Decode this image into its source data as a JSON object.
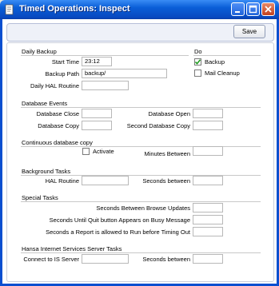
{
  "window": {
    "title": "Timed Operations: Inspect"
  },
  "toolbar": {
    "save_label": "Save"
  },
  "daily_backup": {
    "heading": "Daily Backup",
    "start_time_label": "Start Time",
    "start_time_value": "23:12",
    "backup_path_label": "Backup Path",
    "backup_path_value": "backup/",
    "daily_hal_label": "Daily HAL Routine",
    "daily_hal_value": ""
  },
  "do": {
    "heading": "Do",
    "backup_label": "Backup",
    "backup_checked": true,
    "mail_cleanup_label": "Mail Cleanup",
    "mail_cleanup_checked": false
  },
  "database_events": {
    "heading": "Database Events",
    "close_label": "Database Close",
    "open_label": "Database Open",
    "copy_label": "Database Copy",
    "second_copy_label": "Second Database Copy"
  },
  "continuous_copy": {
    "heading": "Continuous database copy",
    "activate_label": "Activate",
    "activate_checked": false,
    "minutes_between_label": "Minutes Between"
  },
  "background_tasks": {
    "heading": "Background Tasks",
    "hal_label": "HAL Routine",
    "seconds_between_label": "Seconds between"
  },
  "special_tasks": {
    "heading": "Special Tasks",
    "browse_updates_label": "Seconds Between Browse Updates",
    "quit_button_label": "Seconds Until Quit button Appears on Busy Message",
    "report_label": "Seconds a Report is allowed to Run before Timing Out"
  },
  "his_tasks": {
    "heading": "Hansa Internet Services Server Tasks",
    "connect_label": "Connect to IS Server",
    "seconds_between_label": "Seconds between"
  }
}
